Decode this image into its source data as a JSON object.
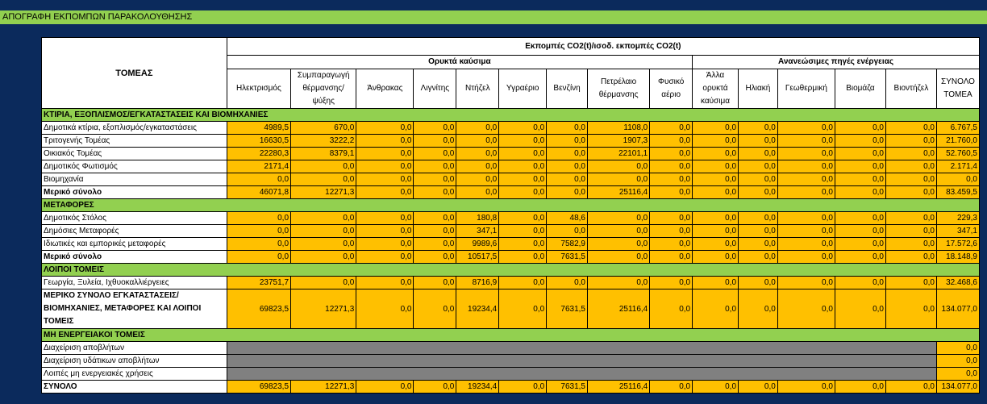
{
  "title": "ΑΠΟΓΡΑΦΗ ΕΚΠΟΜΠΩΝ ΠΑΡΑΚΟΛΟΥΘΗΣΗΣ",
  "headers": {
    "sector": "ΤΟΜΕΑΣ",
    "main": "Εκπομπές CO2(t)/ισοδ. εκπομπές CO2(t)",
    "fossil": "Ορυκτά καύσιμα",
    "renewable": "Ανανεώσιμες πηγές ενέργειας",
    "cols": [
      "Ηλεκτρισμός",
      "Συμπαραγωγή θέρμανσης/ ψύξης",
      "Άνθρακας",
      "Λιγνίτης",
      "Ντήζελ",
      "Υγραέριο",
      "Βενζίνη",
      "Πετρέλαιο θέρμανσης",
      "Φυσικό αέριο",
      "Άλλα ορυκτά καύσιμα",
      "Ηλιακή",
      "Γεωθερμική",
      "Βιομάζα",
      "Βιοντήζελ",
      "ΣΥΝΟΛΟ ΤΟΜΕΑ"
    ]
  },
  "sections": [
    {
      "name": "ΚΤΙΡΙΑ, ΕΞΟΠΛΙΣΜΟΣ/ΕΓΚΑΤΑΣΤΑΣΕΙΣ ΚΑΙ ΒΙΟΜΗΧΑΝΙΕΣ",
      "rows": [
        {
          "label": "Δημοτικά κτίρια, εξοπλισμός/εγκαταστάσεις",
          "values": [
            "4989,5",
            "670,0",
            "0,0",
            "0,0",
            "0,0",
            "0,0",
            "0,0",
            "1108,0",
            "0,0",
            "0,0",
            "0,0",
            "0,0",
            "0,0",
            "0,0"
          ],
          "total": "6.767,5"
        },
        {
          "label": "Τριτογενής Τομέας",
          "values": [
            "16630,5",
            "3222,2",
            "0,0",
            "0,0",
            "0,0",
            "0,0",
            "0,0",
            "1907,3",
            "0,0",
            "0,0",
            "0,0",
            "0,0",
            "0,0",
            "0,0"
          ],
          "total": "21.760,0"
        },
        {
          "label": "Οικιακός Τομέας",
          "values": [
            "22280,3",
            "8379,1",
            "0,0",
            "0,0",
            "0,0",
            "0,0",
            "0,0",
            "22101,1",
            "0,0",
            "0,0",
            "0,0",
            "0,0",
            "0,0",
            "0,0"
          ],
          "total": "52.760,5"
        },
        {
          "label": "Δημοτικός Φωτισμός",
          "values": [
            "2171,4",
            "0,0",
            "0,0",
            "0,0",
            "0,0",
            "0,0",
            "0,0",
            "0,0",
            "0,0",
            "0,0",
            "0,0",
            "0,0",
            "0,0",
            "0,0"
          ],
          "total": "2.171,4"
        },
        {
          "label": "Βιομηχανία",
          "values": [
            "0,0",
            "0,0",
            "0,0",
            "0,0",
            "0,0",
            "0,0",
            "0,0",
            "0,0",
            "0,0",
            "0,0",
            "0,0",
            "0,0",
            "0,0",
            "0,0"
          ],
          "total": "0,0"
        },
        {
          "label": "Μερικό σύνολο",
          "bold": true,
          "values": [
            "46071,8",
            "12271,3",
            "0,0",
            "0,0",
            "0,0",
            "0,0",
            "0,0",
            "25116,4",
            "0,0",
            "0,0",
            "0,0",
            "0,0",
            "0,0",
            "0,0"
          ],
          "total": "83.459,5"
        }
      ]
    },
    {
      "name": "ΜΕΤΑΦΟΡΕΣ",
      "rows": [
        {
          "label": "Δημοτικός Στόλος",
          "values": [
            "0,0",
            "0,0",
            "0,0",
            "0,0",
            "180,8",
            "0,0",
            "48,6",
            "0,0",
            "0,0",
            "0,0",
            "0,0",
            "0,0",
            "0,0",
            "0,0"
          ],
          "total": "229,3"
        },
        {
          "label": "Δημόσιες Μεταφορές",
          "values": [
            "0,0",
            "0,0",
            "0,0",
            "0,0",
            "347,1",
            "0,0",
            "0,0",
            "0,0",
            "0,0",
            "0,0",
            "0,0",
            "0,0",
            "0,0",
            "0,0"
          ],
          "total": "347,1"
        },
        {
          "label": "Ιδιωτικές και εμπορικές μεταφορές",
          "values": [
            "0,0",
            "0,0",
            "0,0",
            "0,0",
            "9989,6",
            "0,0",
            "7582,9",
            "0,0",
            "0,0",
            "0,0",
            "0,0",
            "0,0",
            "0,0",
            "0,0"
          ],
          "total": "17.572,6"
        },
        {
          "label": "Μερικό σύνολο",
          "bold": true,
          "values": [
            "0,0",
            "0,0",
            "0,0",
            "0,0",
            "10517,5",
            "0,0",
            "7631,5",
            "0,0",
            "0,0",
            "0,0",
            "0,0",
            "0,0",
            "0,0",
            "0,0"
          ],
          "total": "18.148,9"
        }
      ]
    },
    {
      "name": "ΛΟΙΠΟΙ ΤΟΜΕΙΣ",
      "rows": [
        {
          "label": "Γεωργία, Ξυλεία, Ιχθυοκαλλιέργειες",
          "values": [
            "23751,7",
            "0,0",
            "0,0",
            "0,0",
            "8716,9",
            "0,0",
            "0,0",
            "0,0",
            "0,0",
            "0,0",
            "0,0",
            "0,0",
            "0,0",
            "0,0"
          ],
          "total": "32.468,6"
        },
        {
          "label": "ΜΕΡΙΚΟ ΣΥΝΟΛΟ ΕΓΚΑΤΑΣΤΑΣΕΙΣ/ΒΙΟΜΗΧΑΝΙΕΣ, ΜΕΤΑΦΟΡΕΣ ΚΑΙ ΛΟΙΠΟΙ ΤΟΜΕΙΣ",
          "big": true,
          "values": [
            "69823,5",
            "12271,3",
            "0,0",
            "0,0",
            "19234,4",
            "0,0",
            "7631,5",
            "25116,4",
            "0,0",
            "0,0",
            "0,0",
            "0,0",
            "0,0",
            "0,0"
          ],
          "total": "134.077,0"
        }
      ]
    },
    {
      "name": "ΜΗ ΕΝΕΡΓΕΙΑΚΟΙ ΤΟΜΕΙΣ",
      "rows": [
        {
          "label": "Διαχείριση αποβλήτων",
          "gray": true,
          "values": [],
          "total": "0,0"
        },
        {
          "label": "Διαχείριση υδάτικων αποβλήτων",
          "gray": true,
          "values": [],
          "total": "0,0"
        },
        {
          "label": "Λοιπές μη ενεργειακές χρήσεις",
          "gray": true,
          "values": [],
          "total": "0,0"
        }
      ]
    }
  ],
  "grand_total": {
    "label": "ΣΥΝΟΛΟ",
    "values": [
      "69823,5",
      "12271,3",
      "0,0",
      "0,0",
      "19234,4",
      "0,0",
      "7631,5",
      "25116,4",
      "0,0",
      "0,0",
      "0,0",
      "0,0",
      "0,0",
      "0,0"
    ],
    "total": "134.077,0"
  }
}
